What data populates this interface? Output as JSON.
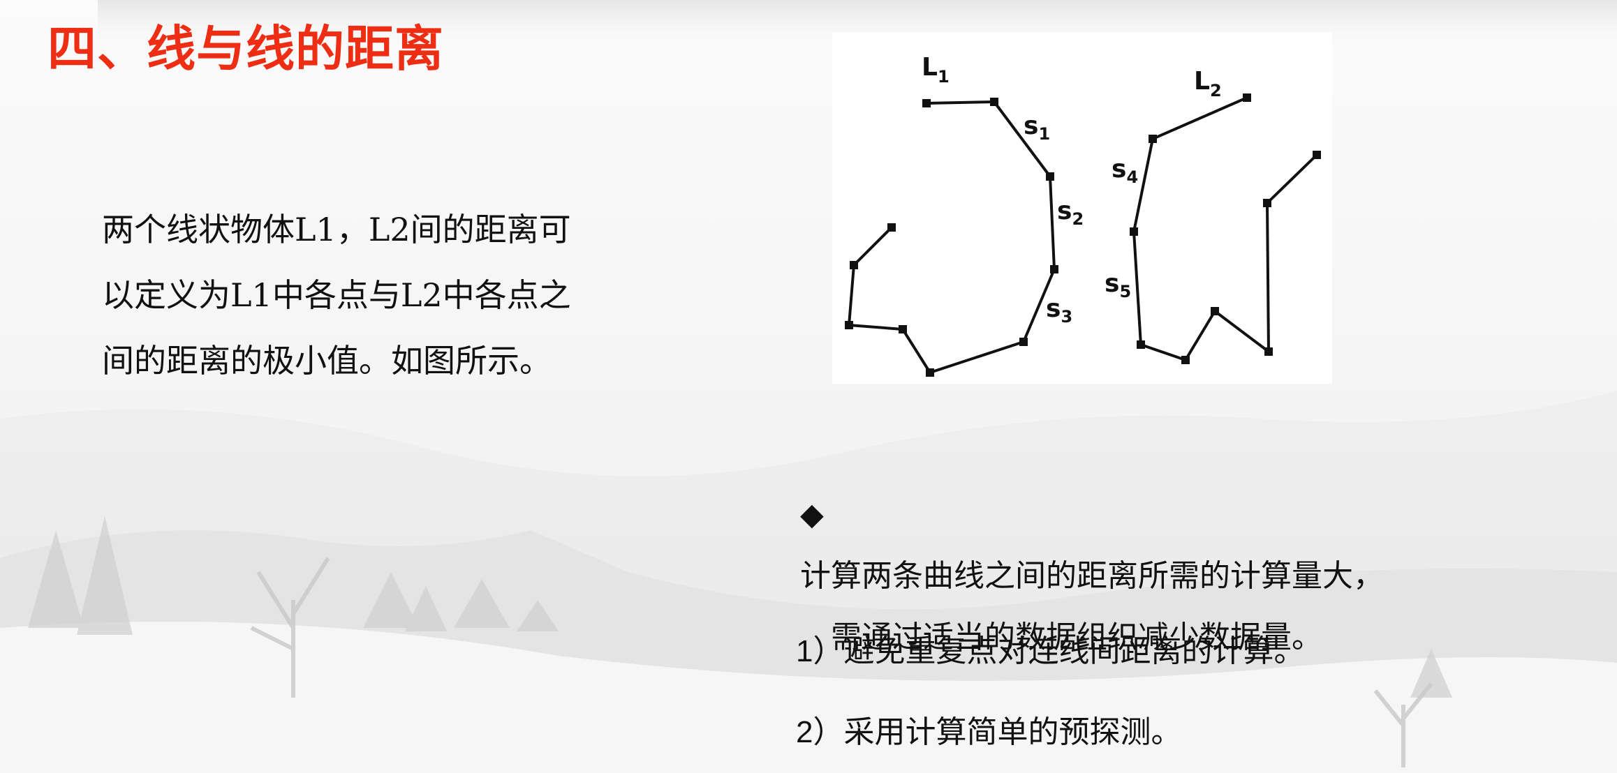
{
  "slide": {
    "title": "四、线与线的距离",
    "intro_lines": [
      "两个线状物体L1，L2间的距离可",
      "以定义为L1中各点与L2中各点之",
      "间的距离的极小值。如图所示。"
    ],
    "figure": {
      "line_labels": [
        {
          "main": "L",
          "sub": "1"
        },
        {
          "main": "L",
          "sub": "2"
        }
      ],
      "segment_labels": [
        {
          "main": "s",
          "sub": "1"
        },
        {
          "main": "s",
          "sub": "2"
        },
        {
          "main": "s",
          "sub": "3"
        },
        {
          "main": "s",
          "sub": "4"
        },
        {
          "main": "s",
          "sub": "5"
        }
      ]
    },
    "note": {
      "bullet": "◆",
      "line1": "计算两条曲线之间的距离所需的计算量大，",
      "line2": "需通过适当的数据组织减少数据量。"
    },
    "items": [
      {
        "num": "1",
        "text": "）避免重复点对连线间距离的计算。"
      },
      {
        "num": "2",
        "text": "）采用计算简单的预探测。"
      }
    ]
  }
}
